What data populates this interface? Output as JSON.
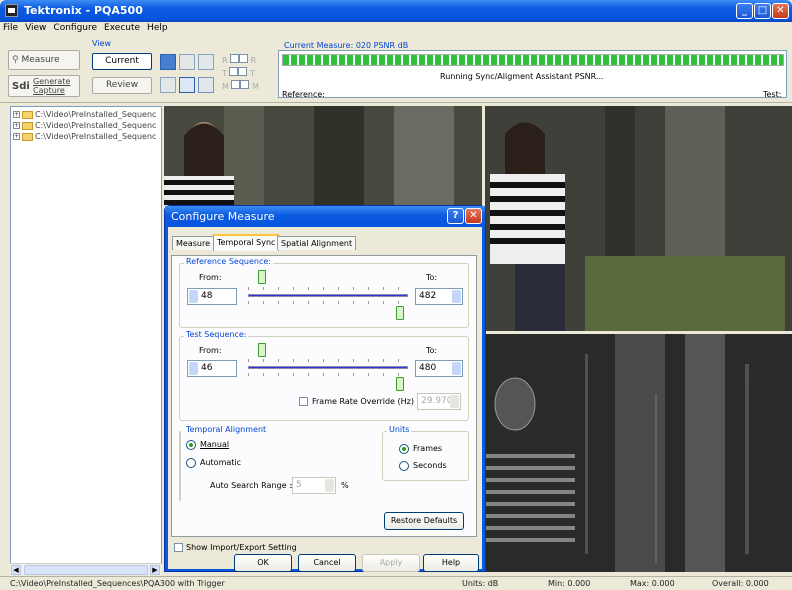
{
  "window": {
    "title": "Tektronix - PQA500"
  },
  "menu": [
    "File",
    "View",
    "Configure",
    "Execute",
    "Help"
  ],
  "toolbar": {
    "measure_label": "Measure",
    "generate_label": "Generate\nCapture",
    "view_group_label": "View",
    "current_label": "Current",
    "review_label": "Review",
    "check_labels_left": [
      "R",
      "T",
      "M"
    ],
    "check_labels_right": [
      "R",
      "T",
      "M"
    ],
    "status_title": "Current Measure: 020 PSNR dB",
    "status_running": "Running Sync/Aligment Assistant PSNR...",
    "reference_label": "Reference:",
    "test_label": "Test:"
  },
  "tree": {
    "items": [
      "C:\\Video\\PreInstalled_Sequenc",
      "C:\\Video\\PreInstalled_Sequenc",
      "C:\\Video\\PreInstalled_Sequenc"
    ]
  },
  "statusbar": {
    "path": "C:\\Video\\PreInstalled_Sequences\\PQA300 with Trigger",
    "units": "Units: dB",
    "min": "Min: 0.000",
    "max": "Max: 0.000",
    "overall": "Overall: 0.000"
  },
  "dialog": {
    "title": "Configure Measure",
    "tabs": [
      "Measure",
      "Temporal Sync",
      "Spatial Alignment"
    ],
    "active_tab": "Temporal Sync",
    "reference": {
      "group": "Reference Sequence:",
      "from_label": "From:",
      "to_label": "To:",
      "from_value": "48",
      "to_value": "482"
    },
    "test": {
      "group": "Test Sequence:",
      "from_label": "From:",
      "to_label": "To:",
      "from_value": "46",
      "to_value": "480"
    },
    "frame_rate_override_label": "Frame Rate Override (Hz)",
    "frame_rate_value": "29.970",
    "temporal_alignment": {
      "group": "Temporal Alignment",
      "manual": "Manual",
      "automatic": "Automatic",
      "selected": "Manual",
      "auto_search_label": "Auto Search Range ±",
      "auto_search_value": "5",
      "auto_search_unit": "%"
    },
    "units": {
      "group": "Units",
      "frames": "Frames",
      "seconds": "Seconds",
      "selected": "Frames"
    },
    "restore_defaults": "Restore Defaults",
    "show_import_export": "Show Import/Export Setting",
    "ok": "OK",
    "cancel": "Cancel",
    "apply": "Apply",
    "help": "Help"
  },
  "colors": {
    "title_blue": "#0a5ae0",
    "progress_green": "#2fc23a",
    "group_label_blue": "#0046d5"
  }
}
